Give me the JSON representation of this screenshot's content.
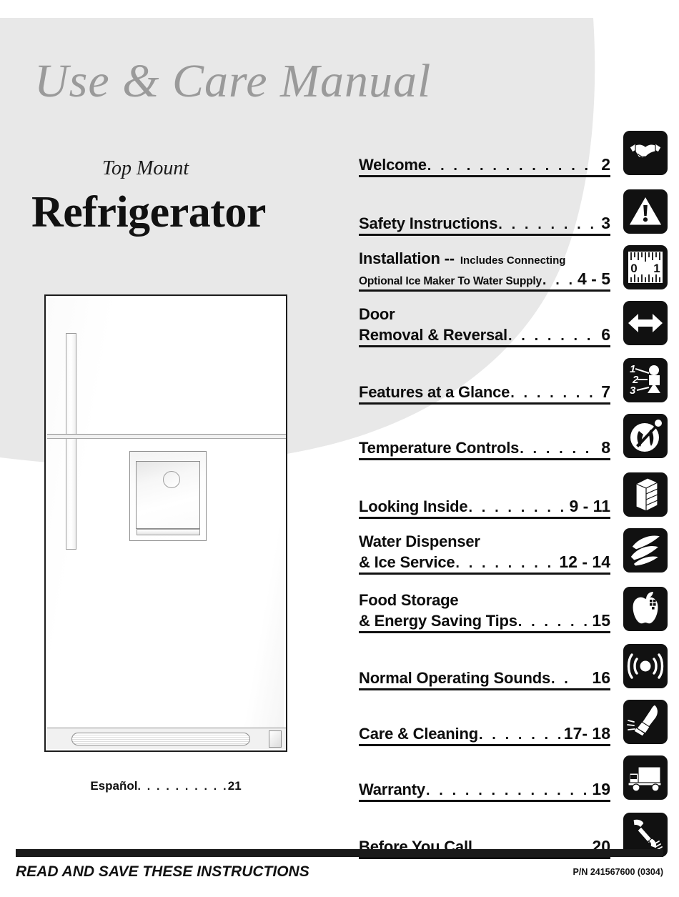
{
  "masthead": {
    "title": "Use & Care Manual",
    "product_kicker": "Top Mount",
    "product_name": "Refrigerator"
  },
  "espanol": {
    "label": "Español",
    "dots": ". . . . . . . . . .",
    "page": "21"
  },
  "toc": {
    "rows": [
      {
        "label": "Welcome",
        "sub": "",
        "dots": ". . . . . . . . . . . . . . . . . . . .",
        "page": "2",
        "icon": "handshake-icon"
      },
      {
        "label": "Safety Instructions",
        "sub": "",
        "dots": ". . . . . . . . . . . .",
        "page": "3",
        "icon": "warning-triangle-icon"
      },
      {
        "label": "Installation --",
        "sub": "Includes Connecting",
        "label2": "Optional Ice Maker To Water Supply",
        "dots": ". . . . .",
        "page": "4 - 5",
        "icon": "ruler-icon"
      },
      {
        "label": "Door",
        "label2": "Removal & Reversal",
        "sub": "",
        "dots": ". . . . . . . . .",
        "page": "6",
        "icon": "double-arrow-icon"
      },
      {
        "label": "Features at a Glance",
        "sub": "",
        "dots": ". . . . . . . . .",
        "page": "7",
        "icon": "numbered-diagram-icon"
      },
      {
        "label": "Temperature Controls",
        "sub": "",
        "dots": ". . . . . . .",
        "page": "8",
        "icon": "temperature-dial-icon"
      },
      {
        "label": "Looking Inside",
        "sub": "",
        "dots": ". . . . . . . . . .",
        "page": "9 - 11",
        "icon": "refrigerator-box-icon"
      },
      {
        "label": "Water Dispenser",
        "label2": "& Ice Service",
        "sub": "",
        "dots": ". . . . . . . . . . .",
        "page": "12 - 14",
        "icon": "water-ice-icon"
      },
      {
        "label": "Food Storage",
        "label2": "& Energy Saving Tips",
        "sub": "",
        "dots": ". . . . . . .",
        "page": "15",
        "icon": "apple-icon"
      },
      {
        "label": "Normal Operating Sounds",
        "sub": "",
        "dots": ". .",
        "page": "16",
        "icon": "sound-waves-icon"
      },
      {
        "label": "Care & Cleaning",
        "sub": "",
        "dots": ". . . . . . . . .",
        "page": "17- 18",
        "icon": "cleaning-hand-icon"
      },
      {
        "label": "Warranty",
        "sub": "",
        "dots": ". . . . . . . . . . . . . . . . . . . .",
        "page": "19",
        "icon": "delivery-truck-icon"
      },
      {
        "label": "Before You Call",
        "sub": "",
        "dots": ". . . . . . . . . . . . . .",
        "page": "20",
        "icon": "telephone-handset-icon"
      }
    ]
  },
  "footer": {
    "note": "READ AND SAVE THESE INSTRUCTIONS",
    "part_number": "P/N 241567600   (0304)"
  },
  "colors": {
    "background_blob": "#e8e8e8",
    "masthead_gray": "#9a9a9a",
    "ink": "#111111"
  }
}
